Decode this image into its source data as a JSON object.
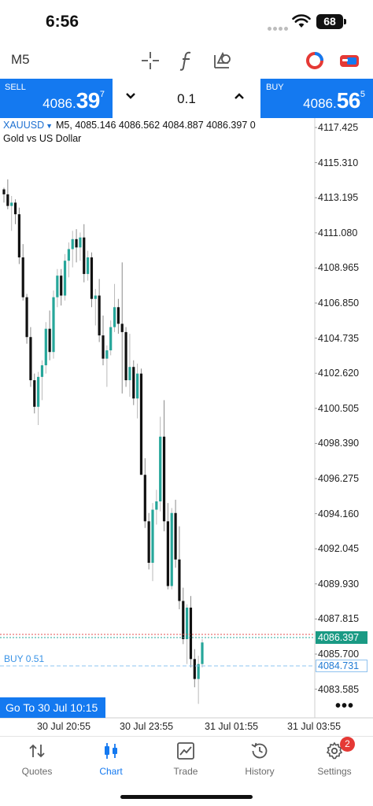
{
  "status": {
    "time": "6:56",
    "battery": "68"
  },
  "toolbar": {
    "timeframe": "M5"
  },
  "trade": {
    "sell_label": "SELL",
    "sell_price_small": "4086.",
    "sell_price_big": "39",
    "sell_price_sup": "7",
    "buy_label": "BUY",
    "buy_price_small": "4086.",
    "buy_price_big": "56",
    "buy_price_sup": "5",
    "volume": "0.1",
    "colors": {
      "button_blue": "#1479f0"
    }
  },
  "chart": {
    "symbol": "XAUUSD",
    "ohlc_line": "M5, 4085.146 4086.562 4084.887 4086.397 0",
    "description": "Gold vs US Dollar",
    "bid_tag": "4086.397",
    "position_tag": "4084.731",
    "position_label": "BUY 0.51",
    "goto_label": "Go To 30 Jul 10:15",
    "more_label": "•••",
    "colors": {
      "bull": "#26a69a",
      "bear": "#111111",
      "ask_line": "#e05252",
      "bid_line": "#26a69a",
      "position_line": "#8cc4f0"
    }
  },
  "chart_data": {
    "type": "candlestick",
    "symbol": "XAUUSD",
    "timeframe": "M5",
    "price_ticks": [
      "4117.425",
      "4115.310",
      "4113.195",
      "4111.080",
      "4108.965",
      "4106.850",
      "4104.735",
      "4102.620",
      "4100.505",
      "4098.390",
      "4096.275",
      "4094.160",
      "4092.045",
      "4089.930",
      "4087.815",
      "4085.700",
      "4083.585"
    ],
    "time_ticks": [
      "30 Jul 20:55",
      "30 Jul 23:55",
      "31 Jul 01:55",
      "31 Jul 03:55"
    ],
    "bid": 4086.397,
    "position": {
      "side": "BUY",
      "volume": 0.51,
      "price": 4084.731
    },
    "candles": [
      [
        4113.7,
        4113.8,
        4112.9,
        4113.4
      ],
      [
        4113.4,
        4114.3,
        4112.5,
        4112.7
      ],
      [
        4112.7,
        4113.3,
        4111.2,
        4112.9
      ],
      [
        4112.9,
        4113.1,
        4111.6,
        4112.2
      ],
      [
        4112.2,
        4112.6,
        4109.2,
        4109.6
      ],
      [
        4109.6,
        4110.4,
        4107.0,
        4107.2
      ],
      [
        4107.2,
        4107.4,
        4104.4,
        4104.8
      ],
      [
        4104.8,
        4105.4,
        4101.8,
        4102.2
      ],
      [
        4102.2,
        4102.6,
        4100.2,
        4100.6
      ],
      [
        4100.6,
        4102.7,
        4099.5,
        4102.4
      ],
      [
        4102.4,
        4103.4,
        4101.0,
        4103.1
      ],
      [
        4103.1,
        4105.7,
        4102.6,
        4105.3
      ],
      [
        4105.3,
        4106.4,
        4103.4,
        4103.9
      ],
      [
        4103.9,
        4107.6,
        4103.5,
        4107.2
      ],
      [
        4107.2,
        4108.9,
        4106.6,
        4108.5
      ],
      [
        4108.5,
        4108.9,
        4106.7,
        4107.3
      ],
      [
        4107.3,
        4109.8,
        4107.0,
        4109.4
      ],
      [
        4109.4,
        4110.5,
        4108.4,
        4110.1
      ],
      [
        4110.1,
        4111.2,
        4109.0,
        4110.7
      ],
      [
        4110.7,
        4111.3,
        4109.3,
        4110.2
      ],
      [
        4110.2,
        4111.1,
        4109.4,
        4110.8
      ],
      [
        4110.8,
        4111.6,
        4108.1,
        4108.6
      ],
      [
        4108.6,
        4110.0,
        4108.2,
        4109.6
      ],
      [
        4109.6,
        4109.9,
        4106.6,
        4107.1
      ],
      [
        4107.1,
        4107.7,
        4105.5,
        4107.3
      ],
      [
        4107.3,
        4108.3,
        4104.5,
        4104.9
      ],
      [
        4104.9,
        4106.1,
        4103.1,
        4103.5
      ],
      [
        4103.5,
        4104.3,
        4101.8,
        4104.0
      ],
      [
        4104.0,
        4105.8,
        4103.7,
        4105.4
      ],
      [
        4105.4,
        4108.0,
        4105.1,
        4106.6
      ],
      [
        4106.6,
        4107.1,
        4105.0,
        4105.6
      ],
      [
        4105.6,
        4109.3,
        4101.4,
        4105.1
      ],
      [
        4105.1,
        4105.4,
        4101.8,
        4102.2
      ],
      [
        4102.2,
        4105.0,
        4101.2,
        4103.0
      ],
      [
        4103.0,
        4103.4,
        4100.7,
        4101.1
      ],
      [
        4101.1,
        4103.2,
        4099.9,
        4102.6
      ],
      [
        4102.6,
        4102.9,
        4098.1,
        4096.5
      ],
      [
        4096.5,
        4097.5,
        4093.3,
        4093.7
      ],
      [
        4093.7,
        4094.2,
        4090.8,
        4091.2
      ],
      [
        4091.2,
        4094.8,
        4090.1,
        4094.4
      ],
      [
        4094.4,
        4095.6,
        4093.5,
        4094.9
      ],
      [
        4094.9,
        4100.0,
        4094.3,
        4098.8
      ],
      [
        4098.8,
        4101.0,
        4093.1,
        4093.7
      ],
      [
        4093.7,
        4094.8,
        4089.6,
        4089.8
      ],
      [
        4089.8,
        4094.5,
        4089.6,
        4094.2
      ],
      [
        4094.2,
        4095.0,
        4090.9,
        4091.4
      ],
      [
        4091.4,
        4093.4,
        4088.4,
        4088.9
      ],
      [
        4088.9,
        4089.7,
        4086.3,
        4086.6
      ],
      [
        4086.6,
        4088.7,
        4085.1,
        4088.5
      ],
      [
        4088.5,
        4089.2,
        4084.9,
        4085.4
      ],
      [
        4085.4,
        4086.0,
        4083.7,
        4084.2
      ],
      [
        4084.2,
        4085.6,
        4082.7,
        4085.1
      ],
      [
        4085.1,
        4086.6,
        4084.9,
        4086.4
      ]
    ]
  },
  "tabs": [
    {
      "label": "Quotes",
      "icon": "quotes-icon"
    },
    {
      "label": "Chart",
      "icon": "chart-icon"
    },
    {
      "label": "Trade",
      "icon": "trade-icon"
    },
    {
      "label": "History",
      "icon": "history-icon"
    },
    {
      "label": "Settings",
      "icon": "settings-icon",
      "badge": "2"
    }
  ]
}
